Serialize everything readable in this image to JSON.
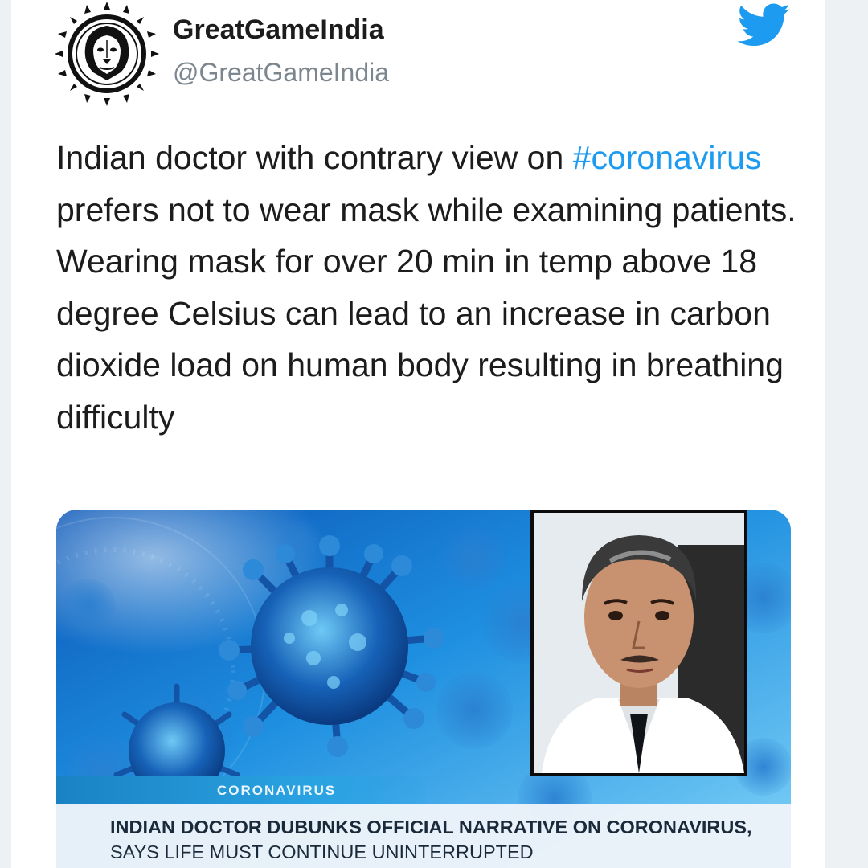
{
  "author": {
    "display_name": "GreatGameIndia",
    "handle": "@GreatGameIndia"
  },
  "icons": {
    "avatar": "lion-emblem-logo",
    "platform": "twitter-bird-icon"
  },
  "colors": {
    "hashtag": "#1d9bf0",
    "text": "#1c1c1c",
    "handle": "#7c868e"
  },
  "tweet": {
    "text_before": "Indian doctor with contrary view on ",
    "hashtag": "#coronavirus",
    "text_after": " prefers not to wear mask while examining patients. Wearing mask for over 20 min in temp above 18 degree Celsius can lead to an increase in carbon dioxide load on human body resulting in breathing difficulty"
  },
  "media": {
    "category_tag": "CORONAVIRUS",
    "headline_bold": "INDIAN DOCTOR DUBUNKS OFFICIAL NARRATIVE ON CORONAVIRUS,",
    "headline_rest": " SAYS LIFE MUST CONTINUE UNINTERRUPTED"
  }
}
